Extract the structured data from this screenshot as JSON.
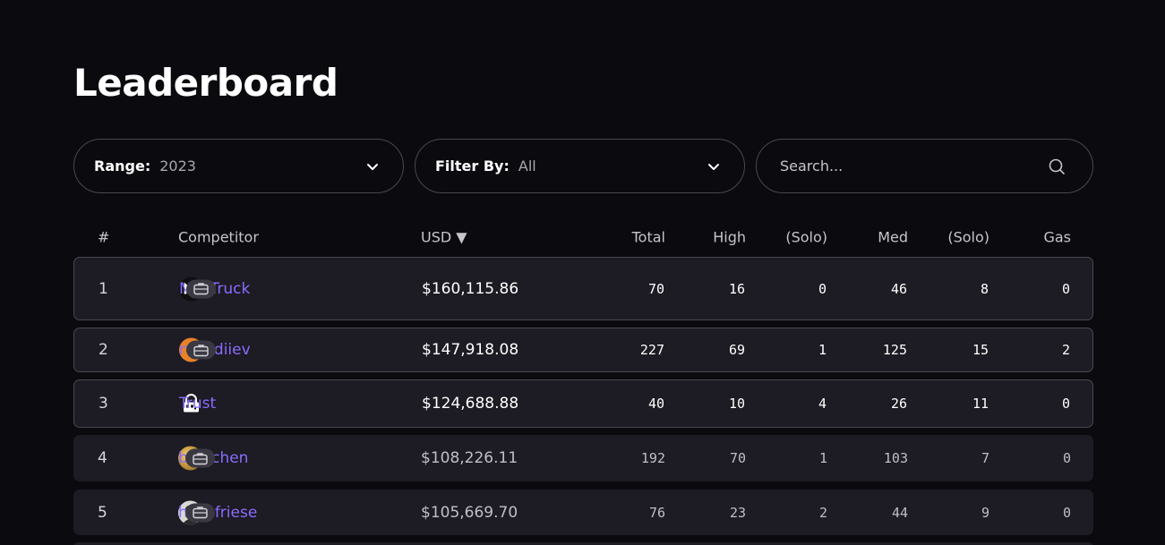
{
  "page": {
    "title": "Leaderboard"
  },
  "controls": {
    "range": {
      "label": "Range:",
      "value": "2023"
    },
    "filter": {
      "label": "Filter By:",
      "value": "All"
    },
    "search": {
      "placeholder": "Search..."
    }
  },
  "table": {
    "headers": {
      "rank": "#",
      "competitor": "Competitor",
      "usd": "USD ▼",
      "total": "Total",
      "high": "High",
      "high_solo": "(Solo)",
      "med": "Med",
      "med_solo": "(Solo)",
      "gas": "Gas"
    },
    "rows": [
      {
        "rank": "1",
        "name": "MiloTruck",
        "usd": "$160,115.86",
        "total": "70",
        "high": "16",
        "high_solo": "0",
        "med": "46",
        "med_solo": "8",
        "gas": "0",
        "has_badge": true,
        "avatar": "milotruck-avatar"
      },
      {
        "rank": "2",
        "name": "rvierdiiev",
        "usd": "$147,918.08",
        "total": "227",
        "high": "69",
        "high_solo": "1",
        "med": "125",
        "med_solo": "15",
        "gas": "2",
        "has_badge": true,
        "avatar": "letter-r-avatar",
        "avatar_letter": "r"
      },
      {
        "rank": "3",
        "name": "Trust",
        "usd": "$124,688.88",
        "total": "40",
        "high": "10",
        "high_solo": "4",
        "med": "26",
        "med_solo": "11",
        "gas": "0",
        "has_badge": false,
        "avatar": "trust-avatar"
      },
      {
        "rank": "4",
        "name": "bin2chen",
        "usd": "$108,226.11",
        "total": "192",
        "high": "70",
        "high_solo": "1",
        "med": "103",
        "med_solo": "7",
        "gas": "0",
        "has_badge": true,
        "avatar": "bin2chen-avatar"
      },
      {
        "rank": "5",
        "name": "hansfriese",
        "usd": "$105,669.70",
        "total": "76",
        "high": "23",
        "high_solo": "2",
        "med": "44",
        "med_solo": "9",
        "gas": "0",
        "has_badge": true,
        "avatar": "hansfriese-avatar"
      }
    ]
  },
  "colors": {
    "background": "#0b0a0e",
    "row_background": "#1d1b23",
    "accent_link": "#8b6cff",
    "border": "#4a4850"
  }
}
